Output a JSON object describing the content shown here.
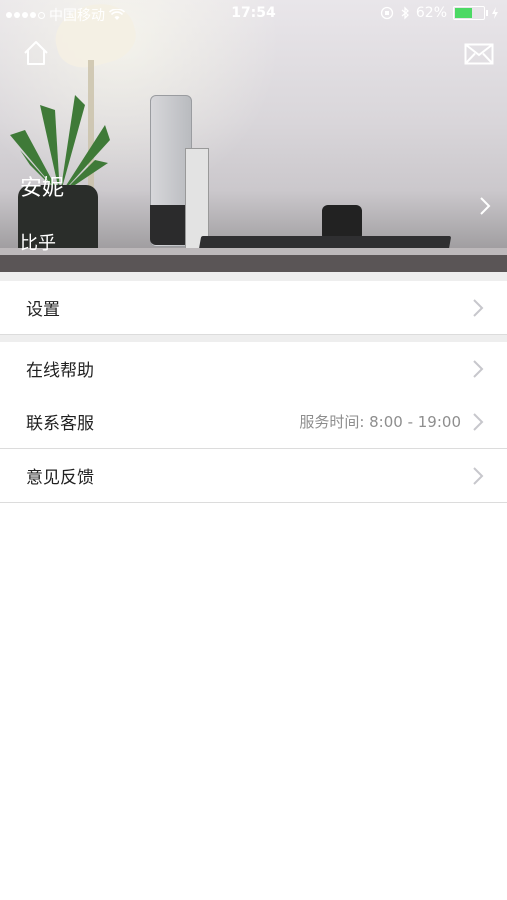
{
  "status_bar": {
    "carrier": "中国移动",
    "time": "17:54",
    "battery_percent": "62%",
    "battery_level": 0.62,
    "signal_filled": 4,
    "signal_total": 5
  },
  "header": {
    "name": "安妮",
    "subtitle": "比乎"
  },
  "menu": {
    "settings": {
      "label": "设置"
    },
    "help": {
      "label": "在线帮助"
    },
    "contact": {
      "label": "联系客服",
      "value": "服务时间: 8:00 - 19:00"
    },
    "feedback": {
      "label": "意见反馈"
    }
  },
  "colors": {
    "battery_fill": "#4cd964",
    "chevron": "#c7c7cc",
    "divider": "#dcdcdc"
  }
}
